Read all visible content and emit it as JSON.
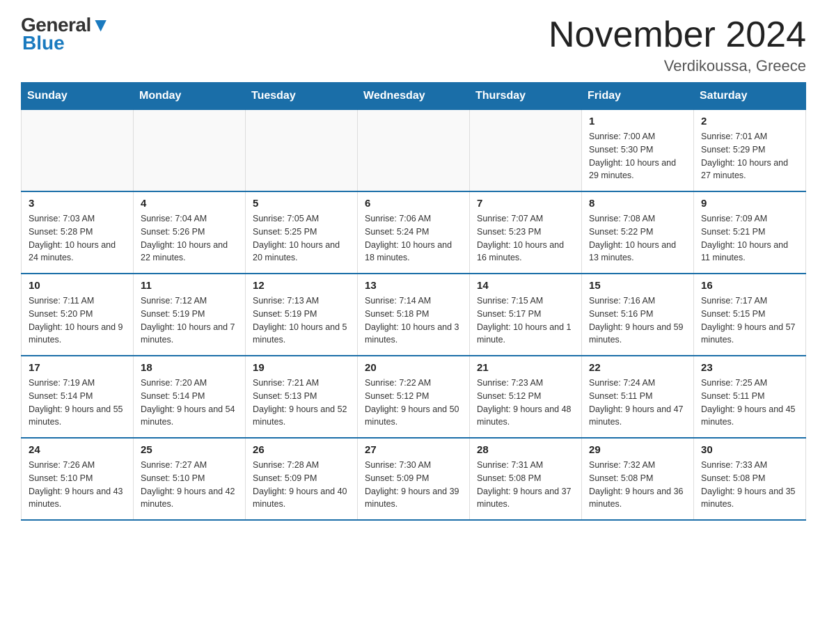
{
  "header": {
    "logo_text_1": "General",
    "logo_text_2": "Blue",
    "month_title": "November 2024",
    "location": "Verdikoussa, Greece"
  },
  "days_of_week": [
    "Sunday",
    "Monday",
    "Tuesday",
    "Wednesday",
    "Thursday",
    "Friday",
    "Saturday"
  ],
  "weeks": [
    [
      {
        "day": "",
        "info": ""
      },
      {
        "day": "",
        "info": ""
      },
      {
        "day": "",
        "info": ""
      },
      {
        "day": "",
        "info": ""
      },
      {
        "day": "",
        "info": ""
      },
      {
        "day": "1",
        "info": "Sunrise: 7:00 AM\nSunset: 5:30 PM\nDaylight: 10 hours and 29 minutes."
      },
      {
        "day": "2",
        "info": "Sunrise: 7:01 AM\nSunset: 5:29 PM\nDaylight: 10 hours and 27 minutes."
      }
    ],
    [
      {
        "day": "3",
        "info": "Sunrise: 7:03 AM\nSunset: 5:28 PM\nDaylight: 10 hours and 24 minutes."
      },
      {
        "day": "4",
        "info": "Sunrise: 7:04 AM\nSunset: 5:26 PM\nDaylight: 10 hours and 22 minutes."
      },
      {
        "day": "5",
        "info": "Sunrise: 7:05 AM\nSunset: 5:25 PM\nDaylight: 10 hours and 20 minutes."
      },
      {
        "day": "6",
        "info": "Sunrise: 7:06 AM\nSunset: 5:24 PM\nDaylight: 10 hours and 18 minutes."
      },
      {
        "day": "7",
        "info": "Sunrise: 7:07 AM\nSunset: 5:23 PM\nDaylight: 10 hours and 16 minutes."
      },
      {
        "day": "8",
        "info": "Sunrise: 7:08 AM\nSunset: 5:22 PM\nDaylight: 10 hours and 13 minutes."
      },
      {
        "day": "9",
        "info": "Sunrise: 7:09 AM\nSunset: 5:21 PM\nDaylight: 10 hours and 11 minutes."
      }
    ],
    [
      {
        "day": "10",
        "info": "Sunrise: 7:11 AM\nSunset: 5:20 PM\nDaylight: 10 hours and 9 minutes."
      },
      {
        "day": "11",
        "info": "Sunrise: 7:12 AM\nSunset: 5:19 PM\nDaylight: 10 hours and 7 minutes."
      },
      {
        "day": "12",
        "info": "Sunrise: 7:13 AM\nSunset: 5:19 PM\nDaylight: 10 hours and 5 minutes."
      },
      {
        "day": "13",
        "info": "Sunrise: 7:14 AM\nSunset: 5:18 PM\nDaylight: 10 hours and 3 minutes."
      },
      {
        "day": "14",
        "info": "Sunrise: 7:15 AM\nSunset: 5:17 PM\nDaylight: 10 hours and 1 minute."
      },
      {
        "day": "15",
        "info": "Sunrise: 7:16 AM\nSunset: 5:16 PM\nDaylight: 9 hours and 59 minutes."
      },
      {
        "day": "16",
        "info": "Sunrise: 7:17 AM\nSunset: 5:15 PM\nDaylight: 9 hours and 57 minutes."
      }
    ],
    [
      {
        "day": "17",
        "info": "Sunrise: 7:19 AM\nSunset: 5:14 PM\nDaylight: 9 hours and 55 minutes."
      },
      {
        "day": "18",
        "info": "Sunrise: 7:20 AM\nSunset: 5:14 PM\nDaylight: 9 hours and 54 minutes."
      },
      {
        "day": "19",
        "info": "Sunrise: 7:21 AM\nSunset: 5:13 PM\nDaylight: 9 hours and 52 minutes."
      },
      {
        "day": "20",
        "info": "Sunrise: 7:22 AM\nSunset: 5:12 PM\nDaylight: 9 hours and 50 minutes."
      },
      {
        "day": "21",
        "info": "Sunrise: 7:23 AM\nSunset: 5:12 PM\nDaylight: 9 hours and 48 minutes."
      },
      {
        "day": "22",
        "info": "Sunrise: 7:24 AM\nSunset: 5:11 PM\nDaylight: 9 hours and 47 minutes."
      },
      {
        "day": "23",
        "info": "Sunrise: 7:25 AM\nSunset: 5:11 PM\nDaylight: 9 hours and 45 minutes."
      }
    ],
    [
      {
        "day": "24",
        "info": "Sunrise: 7:26 AM\nSunset: 5:10 PM\nDaylight: 9 hours and 43 minutes."
      },
      {
        "day": "25",
        "info": "Sunrise: 7:27 AM\nSunset: 5:10 PM\nDaylight: 9 hours and 42 minutes."
      },
      {
        "day": "26",
        "info": "Sunrise: 7:28 AM\nSunset: 5:09 PM\nDaylight: 9 hours and 40 minutes."
      },
      {
        "day": "27",
        "info": "Sunrise: 7:30 AM\nSunset: 5:09 PM\nDaylight: 9 hours and 39 minutes."
      },
      {
        "day": "28",
        "info": "Sunrise: 7:31 AM\nSunset: 5:08 PM\nDaylight: 9 hours and 37 minutes."
      },
      {
        "day": "29",
        "info": "Sunrise: 7:32 AM\nSunset: 5:08 PM\nDaylight: 9 hours and 36 minutes."
      },
      {
        "day": "30",
        "info": "Sunrise: 7:33 AM\nSunset: 5:08 PM\nDaylight: 9 hours and 35 minutes."
      }
    ]
  ]
}
